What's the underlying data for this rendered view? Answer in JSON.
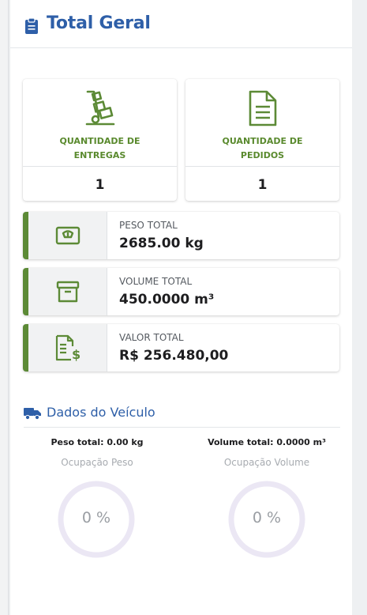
{
  "header": {
    "title": "Total Geral",
    "icon": "clipboard-icon"
  },
  "counts": [
    {
      "label": "QUANTIDADE DE ENTREGAS",
      "value": "1",
      "icon": "hand-truck-icon"
    },
    {
      "label": "QUANTIDADE DE PEDIDOS",
      "value": "1",
      "icon": "document-icon"
    }
  ],
  "stats": [
    {
      "label": "PESO TOTAL",
      "value": "2685.00 kg",
      "icon": "scale-icon"
    },
    {
      "label": "VOLUME TOTAL",
      "value": "450.0000 m³",
      "icon": "box-icon"
    },
    {
      "label": "VALOR TOTAL",
      "value": "R$ 256.480,00",
      "icon": "invoice-dollar-icon"
    }
  ],
  "vehicle": {
    "title": "Dados do Veículo",
    "icon": "truck-icon",
    "peso_total": "Peso total: 0.00 kg",
    "volume_total": "Volume total: 0.0000 m³",
    "occupancy_weight_label": "Ocupação Peso",
    "occupancy_volume_label": "Ocupação Volume",
    "occupancy_weight": "0 %",
    "occupancy_volume": "0 %",
    "occupancy_weight_fraction": 0,
    "occupancy_volume_fraction": 0
  },
  "colors": {
    "accent_blue": "#2e5fa8",
    "accent_green": "#5c8a36",
    "gauge_track": "#ebe7f4"
  }
}
